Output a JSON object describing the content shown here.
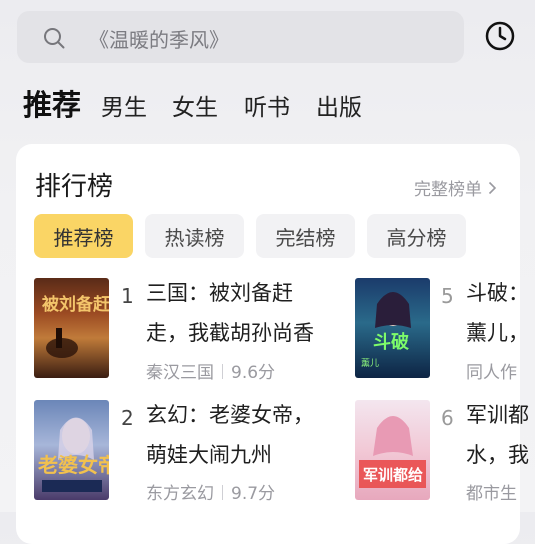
{
  "search": {
    "placeholder": "《温暖的季风》"
  },
  "categories": [
    "推荐",
    "男生",
    "女生",
    "听书",
    "出版"
  ],
  "ranking": {
    "title": "排行榜",
    "more_label": "完整榜单",
    "tabs": [
      "推荐榜",
      "热读榜",
      "完结榜",
      "高分榜"
    ],
    "books": [
      {
        "rank": "1",
        "title_line1": "三国：被刘备赶",
        "title_line2": "走，我截胡孙尚香",
        "genre": "秦汉三国",
        "score": "9.6分"
      },
      {
        "rank": "2",
        "title_line1": "玄幻：老婆女帝，",
        "title_line2": "萌娃大闹九州",
        "genre": "东方玄幻",
        "score": "9.7分"
      },
      {
        "rank": "5",
        "title_line1": "斗破：",
        "title_line2": "薰儿，",
        "genre": "同人作",
        "score": ""
      },
      {
        "rank": "6",
        "title_line1": "军训都",
        "title_line2": "水，我",
        "genre": "都市生",
        "score": ""
      }
    ]
  },
  "colors": {
    "accent": "#fad565",
    "card_bg": "#ffffff",
    "page_bg": "#f1f1f3"
  },
  "icons": {
    "search": "search-icon",
    "history": "clock-icon",
    "more": "chevron-right-icon"
  }
}
